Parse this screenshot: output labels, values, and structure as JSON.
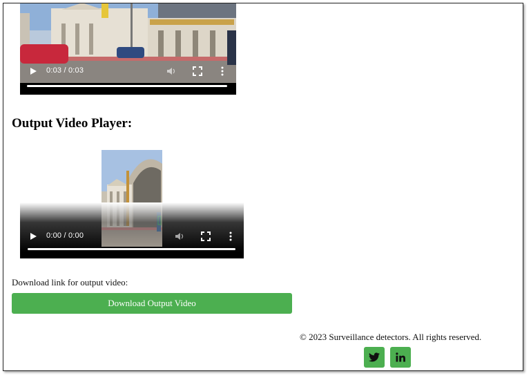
{
  "input_video": {
    "time": "0:03 / 0:03",
    "progress": 1.0,
    "controls": [
      "play-icon",
      "volume-icon",
      "fullscreen-icon",
      "more-options-icon"
    ]
  },
  "output_section": {
    "heading": "Output Video Player:"
  },
  "output_video": {
    "time": "0:00 / 0:00",
    "progress": 1.0,
    "controls": [
      "play-icon",
      "volume-icon",
      "fullscreen-icon",
      "more-options-icon"
    ]
  },
  "download": {
    "label": "Download link for output video:",
    "button_label": "Download Output Video"
  },
  "footer": {
    "copyright": "© 2023 Surveillance detectors. All rights reserved.",
    "social": [
      "twitter-icon",
      "linkedin-icon"
    ]
  },
  "colors": {
    "accent": "#4caf50",
    "video_bg": "#000000",
    "text": "#111111"
  }
}
